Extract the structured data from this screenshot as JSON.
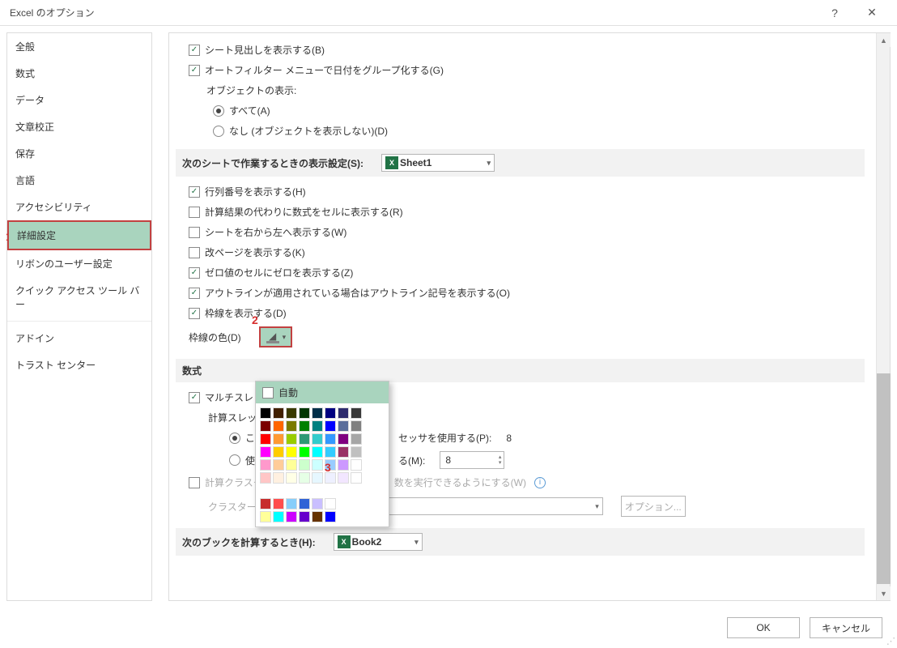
{
  "window": {
    "title": "Excel のオプション"
  },
  "sidebar_items": [
    "全般",
    "数式",
    "データ",
    "文章校正",
    "保存",
    "言語",
    "アクセシビリティ",
    "詳細設定",
    "リボンのユーザー設定",
    "クイック アクセス ツール バー",
    "アドイン",
    "トラスト センター"
  ],
  "annotations": {
    "num1": "1",
    "num2": "2",
    "num3": "3"
  },
  "top_checks": {
    "sheet_tabs": "シート見出しを表示する(B)",
    "autofilter_group_dates": "オートフィルター メニューで日付をグループ化する(G)",
    "object_display_label": "オブジェクトの表示:",
    "object_all": "すべて(A)",
    "object_none": "なし (オブジェクトを表示しない)(D)"
  },
  "sheet_section": {
    "title": "次のシートで作業するときの表示設定(S):",
    "dropdown_value": "Sheet1",
    "show_rowcol": "行列番号を表示する(H)",
    "show_formulas": "計算結果の代わりに数式をセルに表示する(R)",
    "rtl": "シートを右から左へ表示する(W)",
    "page_breaks": "改ページを表示する(K)",
    "zero_vals": "ゼロ値のセルにゼロを表示する(Z)",
    "outline_symbols": "アウトラインが適用されている場合はアウトライン記号を表示する(O)",
    "gridlines": "枠線を表示する(D)",
    "gridline_color_label": "枠線の色(D)"
  },
  "color_popup": {
    "automatic": "自動",
    "rows": [
      [
        "#000000",
        "#412001",
        "#3a3a00",
        "#003600",
        "#002f48",
        "#000080",
        "#2e2c6e",
        "#383838"
      ],
      [
        "#7b0000",
        "#ff6600",
        "#7a7a00",
        "#008000",
        "#008080",
        "#0000ff",
        "#5b6e9b",
        "#808080"
      ],
      [
        "#ff0000",
        "#ff9933",
        "#99cc00",
        "#2e9975",
        "#33cccc",
        "#3399ff",
        "#800080",
        "#a6a6a6"
      ],
      [
        "#ff00ff",
        "#ffcc00",
        "#ffff00",
        "#00ff00",
        "#00ffff",
        "#33ccff",
        "#993366",
        "#c0c0c0"
      ],
      [
        "#ff99cc",
        "#ffcc99",
        "#ffff99",
        "#ccffcc",
        "#ccffff",
        "#99ccff",
        "#cc99ff",
        "#ffffff"
      ],
      [
        "#ffc6c6",
        "#fff0e0",
        "#ffffe6",
        "#e6ffe6",
        "#e6f7ff",
        "#eef0ff",
        "#f2e6ff",
        "#ffffff"
      ],
      [
        "#c72d2d",
        "#ff4d4d",
        "#87cefa",
        "#3063d6",
        "#c9bfff",
        "#ffffff"
      ],
      [
        "#ffff99",
        "#00ffff",
        "#cc00ff",
        "#6600cc",
        "#663300",
        "#0000ff"
      ]
    ]
  },
  "formula_section": {
    "title": "数式",
    "multithread": "マルチスレッ",
    "thread_label": "計算スレッ",
    "use_all_processors_fragment": "セッサを使用する(P):",
    "all_count": "8",
    "use_manual_fragment": "る(M):",
    "manual_value": "8",
    "use_this_fragment_left": "こ",
    "use_manual_left": "使",
    "cluster_calc_fragment": "計算クラスタ",
    "cluster_calc_tail": "数を実行できるようにする(W)",
    "cluster_type_label": "クラスターの種類(C):",
    "cluster_options_btn": "オプション..."
  },
  "book_section": {
    "title": "次のブックを計算するとき(H):",
    "dropdown_value": "Book2"
  },
  "footer": {
    "ok": "OK",
    "cancel": "キャンセル"
  }
}
